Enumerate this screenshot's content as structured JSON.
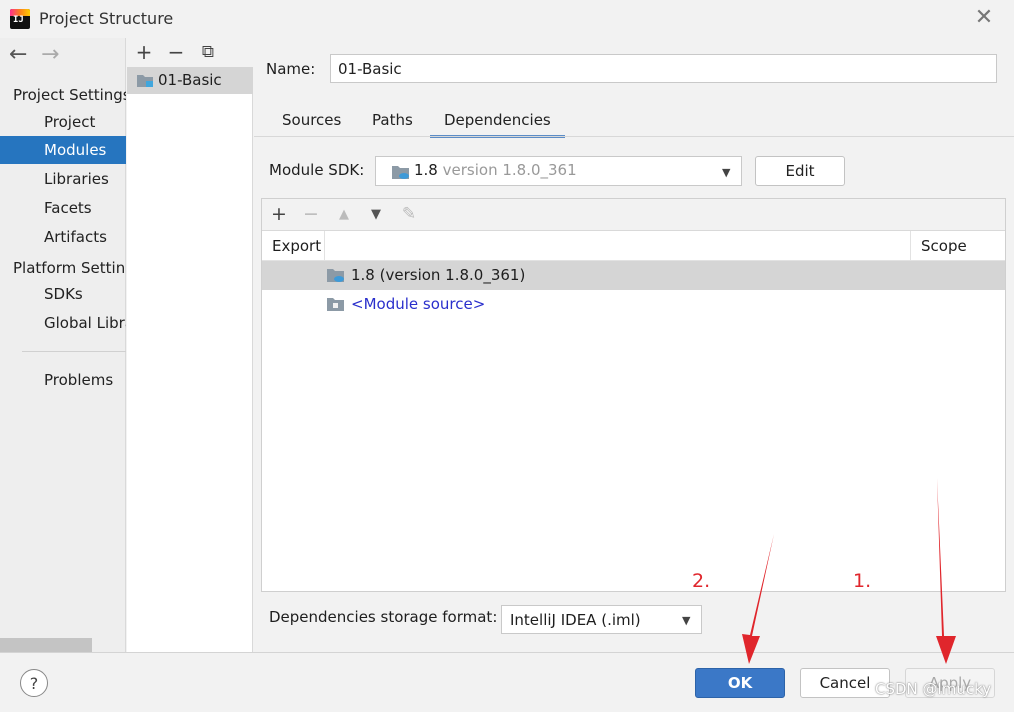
{
  "window": {
    "title": "Project Structure"
  },
  "nav": {
    "back_arrow": "←",
    "forward_arrow": "→",
    "sections": [
      {
        "header": "Project Settings",
        "items": [
          "Project",
          "Modules",
          "Libraries",
          "Facets",
          "Artifacts"
        ]
      },
      {
        "header": "Platform Settings",
        "items": [
          "SDKs",
          "Global Libraries"
        ]
      }
    ],
    "problems": "Problems",
    "selected": "Modules"
  },
  "modules": {
    "tools": [
      "+",
      "−",
      "⧉"
    ],
    "items": [
      "01-Basic"
    ]
  },
  "module": {
    "name_label": "Name:",
    "name_value": "01-Basic",
    "tabs": [
      "Sources",
      "Paths",
      "Dependencies"
    ],
    "active_tab": "Dependencies"
  },
  "sdk": {
    "label": "Module SDK:",
    "name": "1.8",
    "version": "version 1.8.0_361",
    "edit_label": "Edit"
  },
  "dependencies": {
    "toolbar": [
      "+",
      "−",
      "▲",
      "▼",
      "✎"
    ],
    "columns": {
      "export": "Export",
      "scope": "Scope"
    },
    "rows": [
      {
        "label": "1.8 (version 1.8.0_361)",
        "icon": "jdk-folder-icon",
        "selected": true
      },
      {
        "label": "<Module source>",
        "icon": "source-folder-icon",
        "selected": false
      }
    ]
  },
  "storage": {
    "label": "Dependencies storage format:",
    "value": "IntelliJ IDEA (.iml)"
  },
  "buttons": {
    "help": "?",
    "ok": "OK",
    "cancel": "Cancel",
    "apply": "Apply"
  },
  "annotations": {
    "step1": "1.",
    "step2": "2.",
    "color": "#e0262c"
  },
  "watermark": "CSDN @lmucky",
  "colors": {
    "accent": "#2675bf",
    "ok_button": "#3b78c7",
    "link": "#2a2fcc"
  }
}
